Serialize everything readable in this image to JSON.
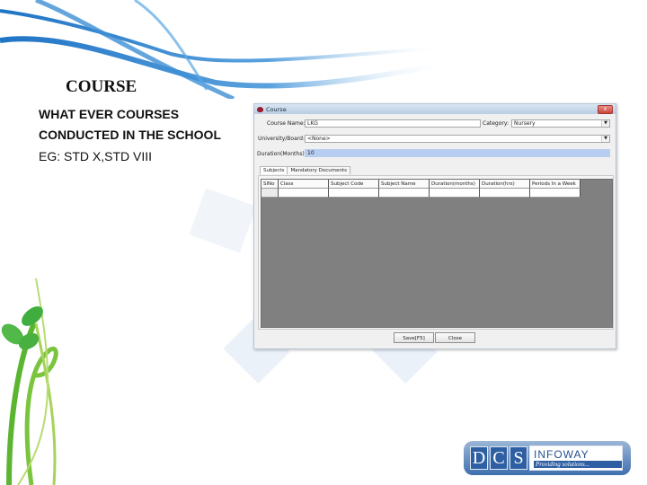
{
  "slide": {
    "title": "COURSE",
    "lines": [
      "WHAT EVER COURSES",
      "CONDUCTED IN THE SCHOOL",
      "EG: STD X,STD VIII"
    ]
  },
  "dialog": {
    "title": "Course",
    "close_label": "x",
    "fields": {
      "course_name": {
        "label": "Course Name:",
        "value": "LKG"
      },
      "category": {
        "label": "Category:",
        "value": "Nursery"
      },
      "university_board": {
        "label": "University/Board:",
        "value": "<None>"
      },
      "duration_months": {
        "label": "Duration(Months):",
        "value": "10"
      }
    },
    "tabs": [
      {
        "label": "Subjects",
        "active": true
      },
      {
        "label": "Mandatory Documents",
        "active": false
      }
    ],
    "grid": {
      "columns": [
        "SlNo",
        "Class",
        "Subject Code",
        "Subject Name",
        "Duration(months)",
        "Duration(hrs)",
        "Periods In a Week"
      ],
      "rows": [
        [
          "",
          "",
          "",
          "",
          "",
          "",
          ""
        ]
      ]
    },
    "buttons": {
      "save": "Save[F5]",
      "close": "Close"
    },
    "dropdown_glyph": "▼"
  },
  "logo": {
    "letters": [
      "D",
      "C",
      "S"
    ],
    "brand": "INFOWAY",
    "tagline": "Providing solutions..."
  },
  "colors": {
    "accent_blue": "#2e5fa3",
    "highlight_field": "#b7cef0",
    "grid_background": "#808080"
  }
}
